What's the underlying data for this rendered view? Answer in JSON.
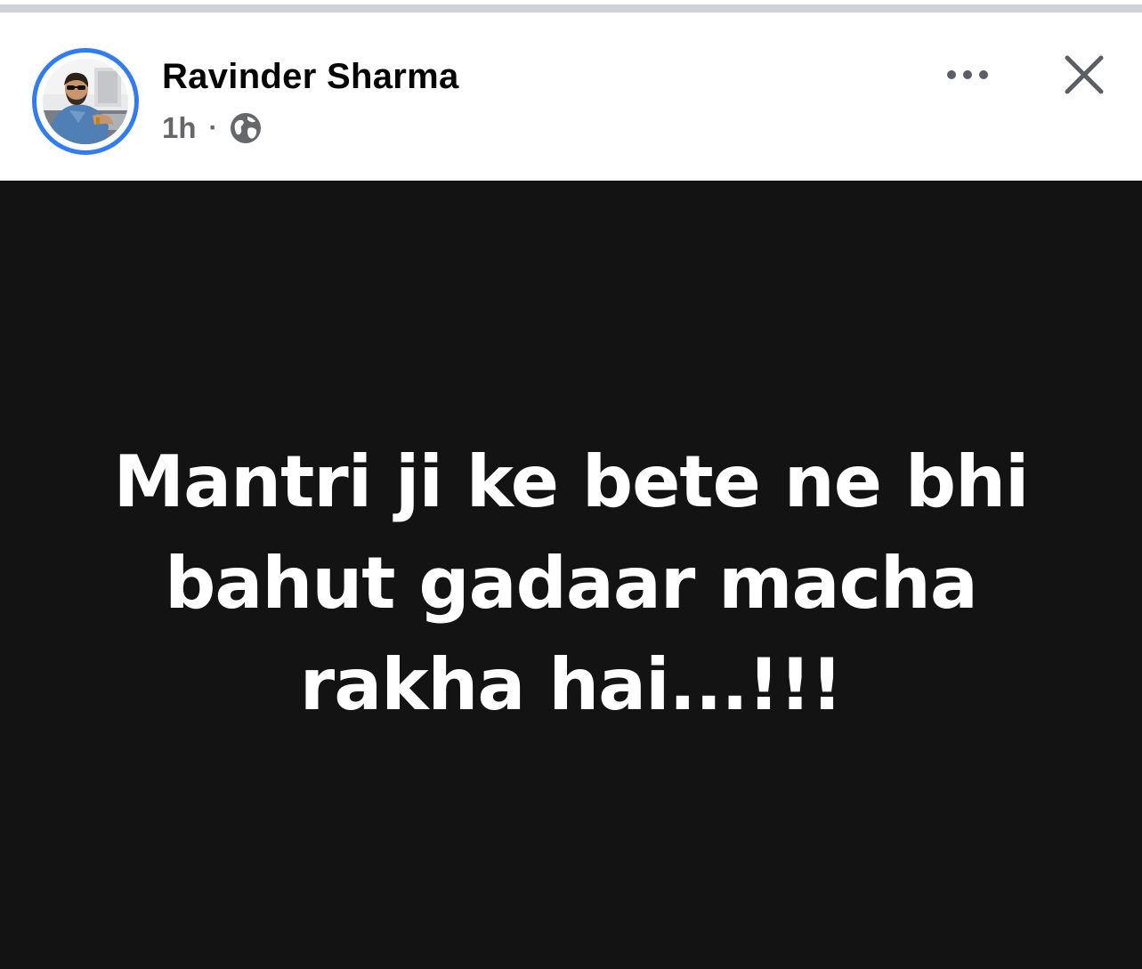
{
  "post": {
    "author_name": "Ravinder Sharma",
    "timestamp": "1h",
    "separator": "·",
    "audience_icon": "globe-icon",
    "more_icon": "more-horizontal-icon",
    "close_icon": "close-icon",
    "text": "Mantri ji ke bete ne bhi bahut gadaar macha rakha hai...!!!"
  },
  "colors": {
    "avatar_ring": "#2f7cf6",
    "post_background": "#131313",
    "post_text": "#ffffff",
    "name_text": "#050505",
    "meta_text": "#65676b"
  }
}
